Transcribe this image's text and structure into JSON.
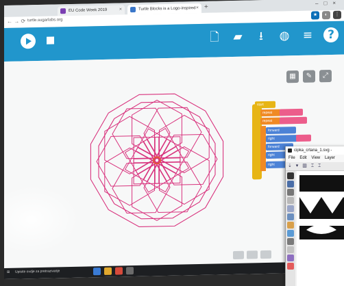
{
  "browser": {
    "tabs": [
      {
        "title": "EU Code Week 2019",
        "color": "#7b3fb2"
      },
      {
        "title": "Turtle Blocks is a Logo-inspired",
        "color": "#3a77c9"
      }
    ],
    "url": "turtle.sugarlabs.org"
  },
  "toolbar": {
    "icons": [
      "play-icon",
      "stop-icon",
      "new-project-icon",
      "open-folder-icon",
      "save-download-icon",
      "planet-icon",
      "menu-icon",
      "help-icon"
    ]
  },
  "canvas": {
    "pattern_color": "#d8327d",
    "center_color": "#e4573a"
  },
  "blocks": {
    "labels": [
      "start",
      "repeat",
      "repeat",
      "forward",
      "right",
      "forward",
      "right",
      "right"
    ]
  },
  "inkscape": {
    "title": "cipka_crtana_1.svg -",
    "menu": [
      "File",
      "Edit",
      "View",
      "Layer"
    ]
  },
  "taskbar": {
    "search_placeholder": "Upisite ovdje za pretrazivanje"
  }
}
